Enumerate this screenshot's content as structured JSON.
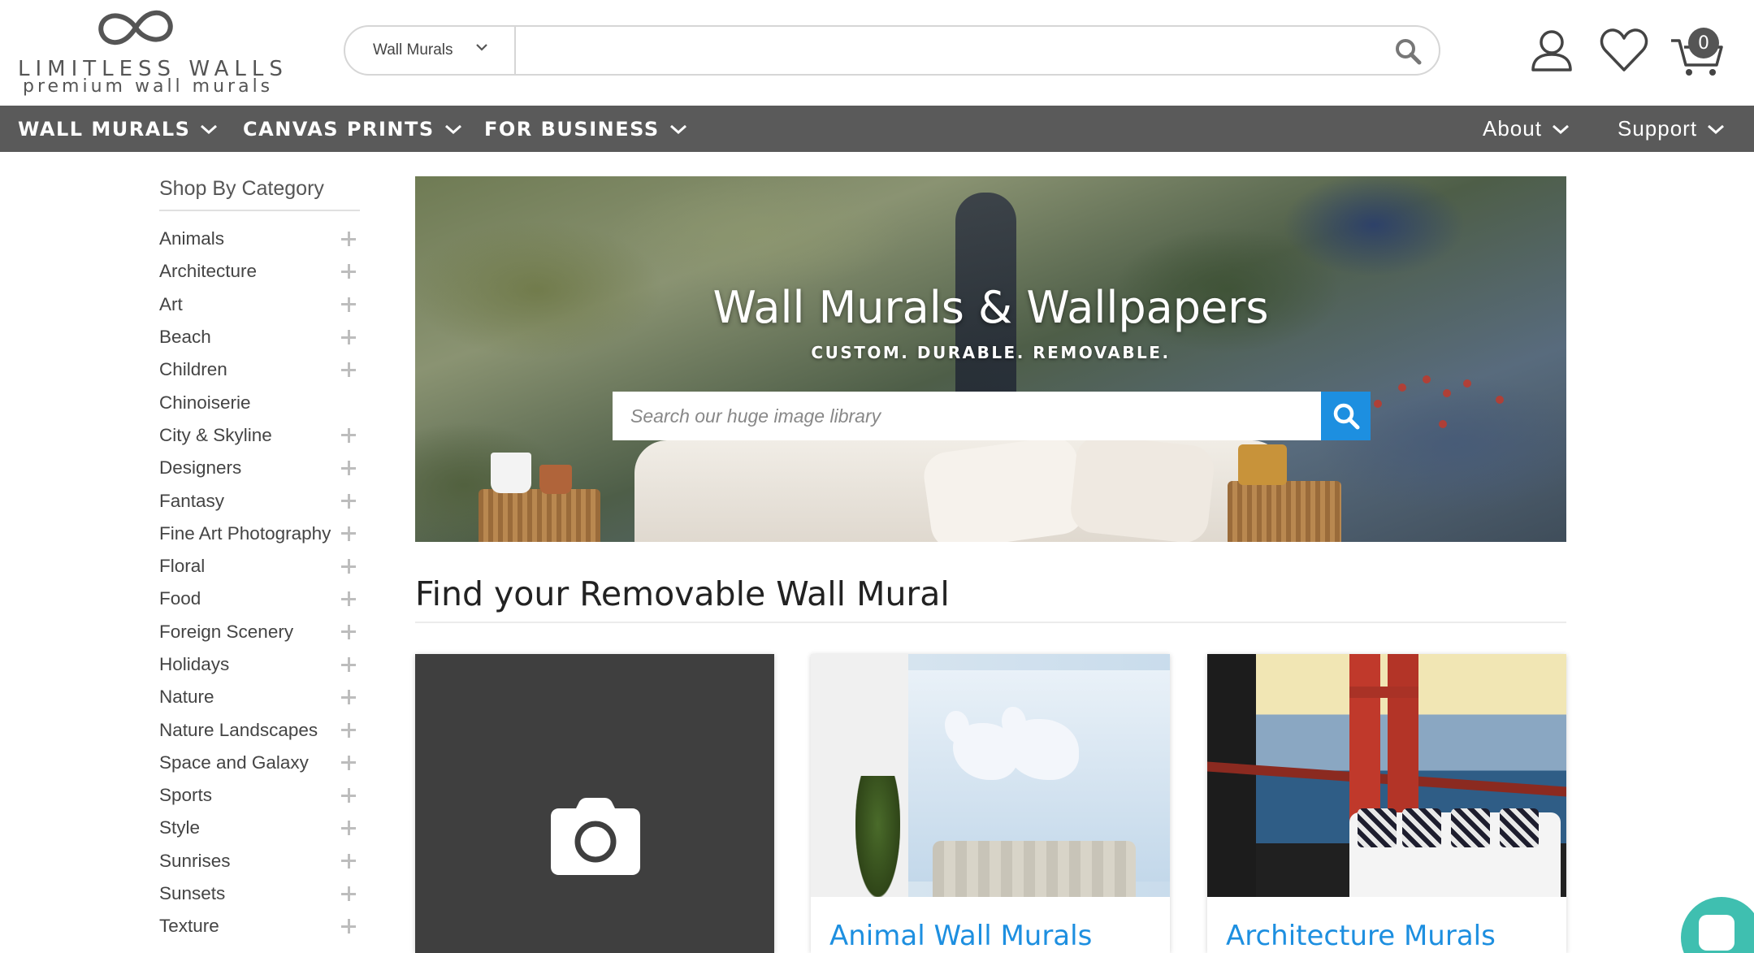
{
  "header": {
    "brand": "LIMITLESS WALLS",
    "tagline": "premium wall murals",
    "search": {
      "category": "Wall Murals",
      "value": "",
      "placeholder": ""
    },
    "cart_count": "0"
  },
  "nav": {
    "left": [
      {
        "label": "WALL MURALS"
      },
      {
        "label": "CANVAS PRINTS"
      },
      {
        "label": "FOR BUSINESS"
      }
    ],
    "right": [
      {
        "label": "About"
      },
      {
        "label": "Support"
      }
    ]
  },
  "sidebar": {
    "title": "Shop By Category",
    "items": [
      {
        "label": "Animals",
        "expandable": true
      },
      {
        "label": "Architecture",
        "expandable": true
      },
      {
        "label": "Art",
        "expandable": true
      },
      {
        "label": "Beach",
        "expandable": true
      },
      {
        "label": "Children",
        "expandable": true
      },
      {
        "label": "Chinoiserie",
        "expandable": false
      },
      {
        "label": "City & Skyline",
        "expandable": true
      },
      {
        "label": "Designers",
        "expandable": true
      },
      {
        "label": "Fantasy",
        "expandable": true
      },
      {
        "label": "Fine Art Photography",
        "expandable": true
      },
      {
        "label": "Floral",
        "expandable": true
      },
      {
        "label": "Food",
        "expandable": true
      },
      {
        "label": "Foreign Scenery",
        "expandable": true
      },
      {
        "label": "Holidays",
        "expandable": true
      },
      {
        "label": "Nature",
        "expandable": true
      },
      {
        "label": "Nature Landscapes",
        "expandable": true
      },
      {
        "label": "Space and Galaxy",
        "expandable": true
      },
      {
        "label": "Sports",
        "expandable": true
      },
      {
        "label": "Style",
        "expandable": true
      },
      {
        "label": "Sunrises",
        "expandable": true
      },
      {
        "label": "Sunsets",
        "expandable": true
      },
      {
        "label": "Texture",
        "expandable": true
      }
    ]
  },
  "hero": {
    "title": "Wall Murals & Wallpapers",
    "subtitle": "CUSTOM. DURABLE. REMOVABLE.",
    "search_placeholder": "Search our huge image library"
  },
  "section": {
    "title": "Find your Removable Wall Mural",
    "cards": [
      {
        "caption": "",
        "icon": "camera-icon"
      },
      {
        "caption": "Animal Wall Murals"
      },
      {
        "caption": "Architecture Murals"
      }
    ]
  },
  "colors": {
    "nav_bg": "#5a5a5a",
    "accent": "#1d8fe0",
    "chat": "#3fbfb0"
  }
}
